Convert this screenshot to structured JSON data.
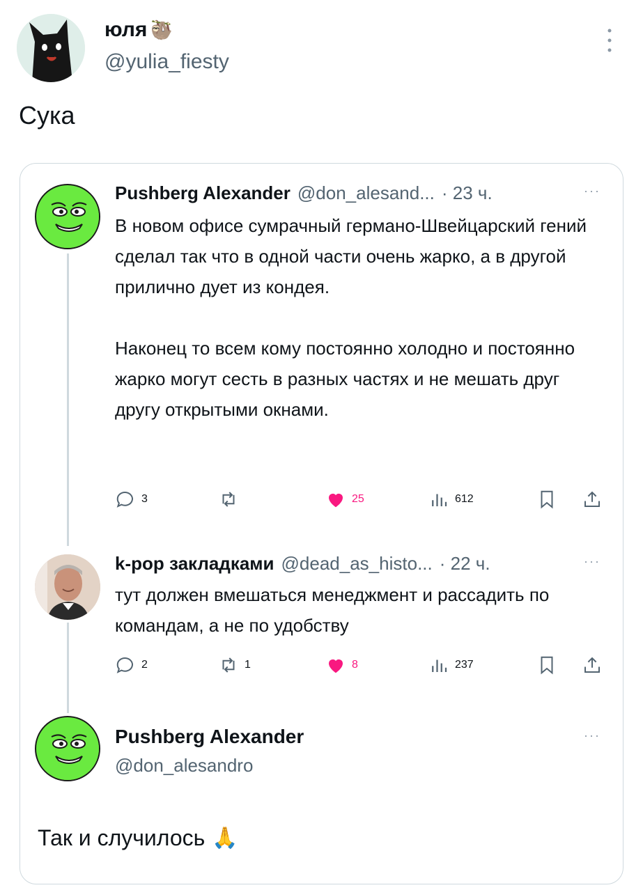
{
  "author": {
    "name": "юля",
    "emoji": "🦥",
    "handle": "@yulia_fiesty"
  },
  "tweet": {
    "text": "Сука"
  },
  "thread": [
    {
      "name": "Pushberg Alexander",
      "handle": "@don_alesand...",
      "time": "· 23 ч.",
      "paragraphs": [
        "В новом офисе сумрачный германо-Швейцарский гений сделал так что в одной части очень жарко, а в другой прилично дует из кондея.",
        "Наконец то всем кому постоянно холодно и постоянно жарко могут сесть в разных частях и не мешать друг другу открытыми окнами."
      ],
      "stats": {
        "replies": "3",
        "retweets": "",
        "likes": "25",
        "views": "612"
      }
    },
    {
      "name": "k-pop закладками",
      "handle": "@dead_as_histo...",
      "time": "· 22 ч.",
      "paragraphs": [
        "тут должен вмешаться менеджмент и рассадить по командам, а не по удобству"
      ],
      "stats": {
        "replies": "2",
        "retweets": "1",
        "likes": "8",
        "views": "237"
      }
    }
  ],
  "quoted": {
    "name": "Pushberg Alexander",
    "handle": "@don_alesandro",
    "text": "Так и случилось",
    "emoji": "🙏"
  },
  "more_label": "···",
  "colors": {
    "text": "#0f1419",
    "secondary": "#536471",
    "border": "#cfd9de",
    "like": "#f91880",
    "avatar_green": "#6aea40"
  }
}
